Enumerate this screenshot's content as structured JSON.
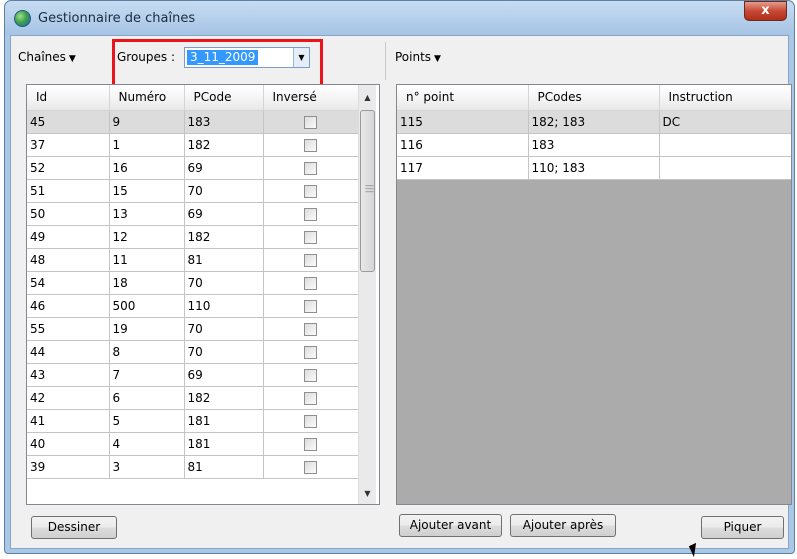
{
  "window": {
    "title": "Gestionnaire de chaînes",
    "close_symbol": "x"
  },
  "toolbar_left": {
    "chaines_menu": "Chaînes",
    "groupes_label": "Groupes :",
    "groupes_value": "3_11_2009"
  },
  "toolbar_right": {
    "points_menu": "Points"
  },
  "chains_table": {
    "headers": [
      "Id",
      "Numéro",
      "PCode",
      "Inversé"
    ],
    "rows": [
      [
        "45",
        "9",
        "183"
      ],
      [
        "37",
        "1",
        "182"
      ],
      [
        "52",
        "16",
        "69"
      ],
      [
        "51",
        "15",
        "70"
      ],
      [
        "50",
        "13",
        "69"
      ],
      [
        "49",
        "12",
        "182"
      ],
      [
        "48",
        "11",
        "81"
      ],
      [
        "54",
        "18",
        "70"
      ],
      [
        "46",
        "500",
        "110"
      ],
      [
        "55",
        "19",
        "70"
      ],
      [
        "44",
        "8",
        "70"
      ],
      [
        "43",
        "7",
        "69"
      ],
      [
        "42",
        "6",
        "182"
      ],
      [
        "41",
        "5",
        "181"
      ],
      [
        "40",
        "4",
        "181"
      ],
      [
        "39",
        "3",
        "81"
      ]
    ]
  },
  "points_table": {
    "headers": [
      "n° point",
      "PCodes",
      "Instruction"
    ],
    "rows": [
      [
        "115",
        "182; 183",
        "DC"
      ],
      [
        "116",
        "183",
        ""
      ],
      [
        "117",
        "110; 183",
        ""
      ]
    ]
  },
  "buttons": {
    "dessiner": "Dessiner",
    "ajouter_avant": "Ajouter avant",
    "ajouter_apres": "Ajouter après",
    "piquer": "Piquer"
  },
  "icons": {
    "app": "globe-icon",
    "close": "close-icon",
    "dropdown": "chevron-down-icon"
  },
  "colors": {
    "highlight": "#e8151b",
    "selection": "#3399ff",
    "titlebar": "#a6c4e5"
  }
}
